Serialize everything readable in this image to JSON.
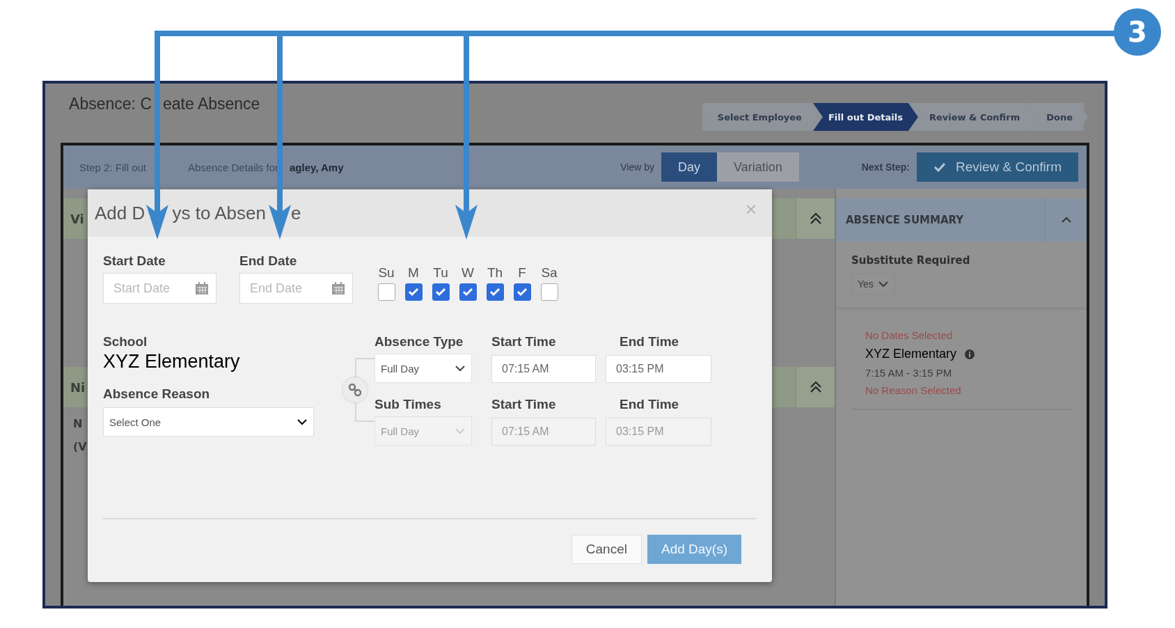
{
  "annotation": {
    "callout_number": "3"
  },
  "page": {
    "title_parts": [
      "Absence: C",
      "eate Absence"
    ],
    "wizard_steps": [
      {
        "label": "Select Employee",
        "selected": false
      },
      {
        "label": "Fill out Details",
        "selected": true
      },
      {
        "label": "Review & Confirm",
        "selected": false
      },
      {
        "label": "Done",
        "selected": false
      }
    ]
  },
  "toolbar": {
    "step_text_parts": [
      "Step 2: Fill out",
      "Absence Details for",
      "agley, Amy"
    ],
    "view_by_label": "View by",
    "view_tabs": [
      {
        "label": "Day",
        "selected": true
      },
      {
        "label": "Variation",
        "selected": false
      }
    ],
    "next_step_label": "Next Step:",
    "next_step_button": "Review & Confirm"
  },
  "background_sections": [
    {
      "title": "Vi"
    },
    {
      "title": "Ni"
    }
  ],
  "background_fragments": [
    "N",
    "(V"
  ],
  "summary": {
    "title": "ABSENCE SUMMARY",
    "substitute_label": "Substitute Required",
    "substitute_value": "Yes",
    "dates_status": "No Dates Selected",
    "school": "XYZ Elementary",
    "times": "7:15 AM - 3:15 PM",
    "reason_status": "No Reason Selected"
  },
  "dialog": {
    "title_parts": [
      "Add D",
      "ys to Absen",
      "e"
    ],
    "close": "×",
    "start_date": {
      "label": "Start Date",
      "placeholder": "Start Date"
    },
    "end_date": {
      "label": "End Date",
      "placeholder": "End Date"
    },
    "weekdays": [
      {
        "label": "Su",
        "checked": false
      },
      {
        "label": "M",
        "checked": true
      },
      {
        "label": "Tu",
        "checked": true
      },
      {
        "label": "W",
        "checked": true
      },
      {
        "label": "Th",
        "checked": true
      },
      {
        "label": "F",
        "checked": true
      },
      {
        "label": "Sa",
        "checked": false
      }
    ],
    "school_label": "School",
    "school": "XYZ Elementary",
    "reason": {
      "label": "Absence Reason",
      "value": "Select One"
    },
    "time_rows": [
      {
        "label": "Absence Type",
        "value": "Full Day",
        "start_label": "Start Time",
        "start": "07:15 AM",
        "end_label": "End Time",
        "end": "03:15 PM",
        "disabled": false
      },
      {
        "label": "Sub Times",
        "value": "Full Day",
        "start_label": "Start Time",
        "start": "07:15 AM",
        "end_label": "End Time",
        "end": "03:15 PM",
        "disabled": true
      }
    ],
    "cancel_button": "Cancel",
    "submit_button": "Add Day(s)"
  }
}
